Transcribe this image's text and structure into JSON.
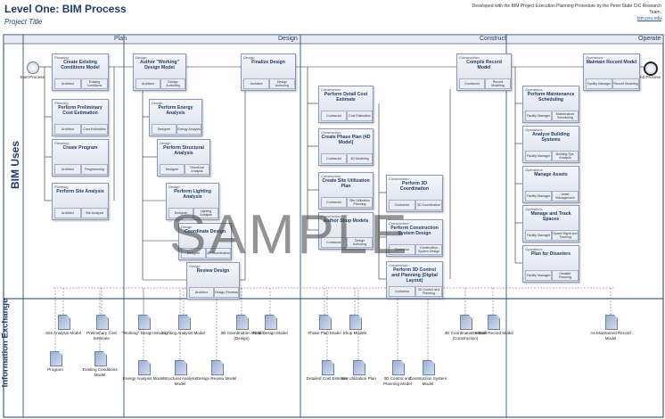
{
  "header": {
    "title": "Level One: BIM Process",
    "subtitle": "Project Title",
    "credit_line": "Developed with the BIM Project Execution Planning Procedure by the Penn State CIC Research Team.",
    "credit_link": "bim.psu.edu"
  },
  "phases": [
    "Plan",
    "Design",
    "Construct",
    "Operate"
  ],
  "lanes": {
    "bim_uses": "BIM Uses",
    "info_exchange": "Information Exchange"
  },
  "events": {
    "start": "Start Process",
    "end": "End Process"
  },
  "watermark": "SAMPLE",
  "processes": [
    {
      "cat": "Planning",
      "title": "Create Existing Conditions Model",
      "cells": [
        "Architect",
        "Existing Conditions"
      ]
    },
    {
      "cat": "Planning",
      "title": "Perform Preliminary Cost Estimation",
      "cells": [
        "Architect",
        "Cost Estimation"
      ]
    },
    {
      "cat": "Planning",
      "title": "Create Program",
      "cells": [
        "Architect",
        "Programming"
      ]
    },
    {
      "cat": "Planning",
      "title": "Perform Site Analysis",
      "cells": [
        "Architect",
        "Site Analysis"
      ]
    },
    {
      "cat": "Design",
      "title": "Author \"Working\" Design Model",
      "cells": [
        "Architect",
        "Design Authoring"
      ]
    },
    {
      "cat": "Design",
      "title": "Perform Energy Analysis",
      "cells": [
        "Designer",
        "Energy Analysis"
      ]
    },
    {
      "cat": "Design",
      "title": "Perform Structural Analysis",
      "cells": [
        "Designer",
        "Structural Analysis"
      ]
    },
    {
      "cat": "Design",
      "title": "Perform Lighting Analysis",
      "cells": [
        "Designer",
        "Lighting Analysis"
      ]
    },
    {
      "cat": "Design",
      "title": "Coordinate Design",
      "cells": [
        "Designer",
        "3D Coordination"
      ]
    },
    {
      "cat": "Design",
      "title": "Review Design",
      "cells": [
        "Architect",
        "Design Reviews"
      ]
    },
    {
      "cat": "Design",
      "title": "Finalize Design",
      "cells": [
        "Architect",
        "Design Authoring"
      ]
    },
    {
      "cat": "Construction",
      "title": "Perform Detail Cost Estimate",
      "cells": [
        "Contractor",
        "Cost Estimation"
      ]
    },
    {
      "cat": "Construction",
      "title": "Create Phase Plan (4D Model)",
      "cells": [
        "Contractor",
        "4D Modeling"
      ]
    },
    {
      "cat": "Construction",
      "title": "Create Site Utilization Plan",
      "cells": [
        "Contractor",
        "Site Utilization Planning"
      ]
    },
    {
      "cat": "Construction",
      "title": "Author Shop Models",
      "cells": [
        "Contractor",
        "Design Authoring"
      ]
    },
    {
      "cat": "Construction",
      "title": "Perform 3D Coordination",
      "cells": [
        "Contractor",
        "3D Coordination"
      ]
    },
    {
      "cat": "Construction",
      "title": "Perform Construction System Design",
      "cells": [
        "Contractor",
        "Construction System Design"
      ]
    },
    {
      "cat": "Construction",
      "title": "Perform 3D Control and Planning (Digital Layout)",
      "cells": [
        "Contractor",
        "3D Control and Planning"
      ]
    },
    {
      "cat": "Construction",
      "title": "Compile Record Model",
      "cells": [
        "Contractor",
        "Record Modeling"
      ]
    },
    {
      "cat": "Operations",
      "title": "Maintain Record Model",
      "cells": [
        "Facility Manager",
        "Record Modeling"
      ]
    },
    {
      "cat": "Operations",
      "title": "Perform Maintenance Scheduling",
      "cells": [
        "Facility Manager",
        "Maintenance Scheduling"
      ]
    },
    {
      "cat": "Operations",
      "title": "Analyze Building Systems",
      "cells": [
        "Facility Manager",
        "Building Sys. Analysis"
      ]
    },
    {
      "cat": "Operations",
      "title": "Manage Assets",
      "cells": [
        "Facility Manager",
        "Asset Management"
      ]
    },
    {
      "cat": "Operations",
      "title": "Manage and Track Spaces",
      "cells": [
        "Facility Manager",
        "Space Mgmt and Tracking"
      ]
    },
    {
      "cat": "Operations",
      "title": "Plan for Disasters",
      "cells": [
        "Facility Manager",
        "Disaster Planning"
      ]
    }
  ],
  "documents": [
    "Site Analysis Model",
    "Preliminary Cost Estimate",
    "Program",
    "Existing Conditions Model",
    "\"Working\" Design Model",
    "Lighting Analysis Model",
    "3D Coordination Model (Design)",
    "Final Design Model",
    "Energy Analysis Model",
    "Structural Analysis Model",
    "Design Review Model",
    "Phase Plan Model",
    "Shop Models",
    "Detailed Cost Estimate",
    "Site Utilization Plan",
    "3D Control and Planning Model",
    "Construction System Model",
    "3D Coordination Model (Construction)",
    "As-Built Record Model",
    "As-Maintained Record Model"
  ]
}
